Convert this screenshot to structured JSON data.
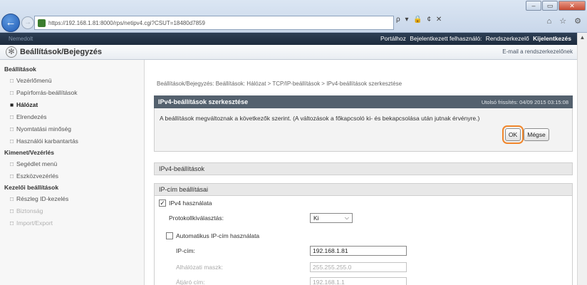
{
  "browser": {
    "url": "https://192.168.1.81:8000/rps/netipv4.cgi?CSUT=18480d7859",
    "win_minimize": "–",
    "win_maximize": "▭",
    "win_close": "✕",
    "back_glyph": "←",
    "forward_glyph": "→",
    "addr_controls": "ρ ▾ 🔒 ¢ ✕",
    "toolbar_icons": "⌂ ☆ ⚙"
  },
  "banner": {
    "device_name": "Nemedolt",
    "portal": "Portálhoz",
    "logged_in_label": "Bejelentkezett felhasználó:",
    "user": "Rendszerkezelő",
    "logout": "Kijelentkezés"
  },
  "header": {
    "title": "Beállítások/Bejegyzés",
    "mail_link": "E-mail a rendszerkezelőnek"
  },
  "sidebar": {
    "groups": [
      {
        "label": "Beállítások",
        "items": [
          {
            "label": "Vezérlőmenü",
            "active": false
          },
          {
            "label": "Papírforrás-beállítások",
            "active": false
          },
          {
            "label": "Hálózat",
            "active": true
          },
          {
            "label": "Elrendezés",
            "active": false
          },
          {
            "label": "Nyomtatási minőség",
            "active": false
          },
          {
            "label": "Használói karbantartás",
            "active": false
          }
        ]
      },
      {
        "label": "Kimenet/Vezérlés",
        "items": [
          {
            "label": "Segédlet menü",
            "active": false
          },
          {
            "label": "Eszközvezérlés",
            "active": false
          }
        ]
      },
      {
        "label": "Kezelői beállítások",
        "items": [
          {
            "label": "Részleg ID-kezelés",
            "active": false
          },
          {
            "label": "Biztonság",
            "active": false
          },
          {
            "label": "Import/Export",
            "active": false
          }
        ]
      }
    ]
  },
  "main": {
    "breadcrumb": "Beállítások/Bejegyzés: Beállítások: Hálózat > TCP/IP-beállítások > IPv4-beállítások szerkesztése",
    "panel_title": "IPv4-beállítások szerkesztése",
    "last_update": "Utolsó frissítés: 04/09 2015 03:15:08",
    "message": "A beállítások megváltoznak a következők szerint. (A változások a főkapcsoló ki- és bekapcsolása után jutnak érvényre.)",
    "ok_label": "OK",
    "cancel_label": "Mégse",
    "section_ipv4": "IPv4-beállítások",
    "section_ip": "IP-cím beállításai",
    "use_ipv4": "IPv4 használata",
    "protocol_label": "Protokollkiválasztás:",
    "protocol_value": "Ki",
    "auto_ip": "Automatikus IP-cím használata",
    "ip_label": "IP-cím:",
    "ip_value": "192.168.1.81",
    "subnet_label": "Alhálózati maszk:",
    "subnet_value": "255.255.255.0",
    "gateway_label": "Átjáró cím:",
    "gateway_value": "192.168.1.1"
  }
}
